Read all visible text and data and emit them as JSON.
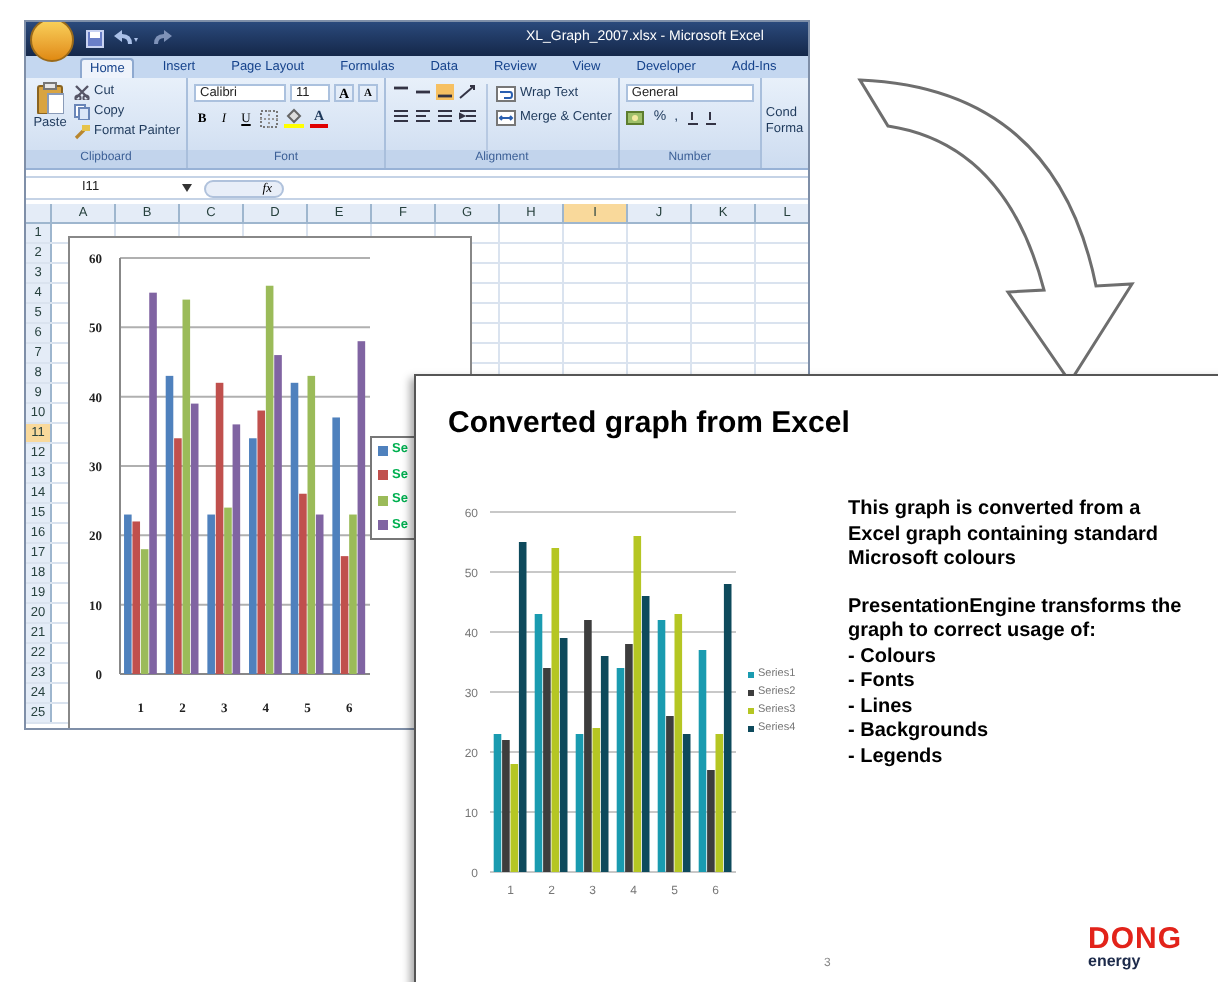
{
  "excel": {
    "title": "XL_Graph_2007.xlsx - Microsoft Excel",
    "tabs": [
      {
        "label": "Home",
        "selected": true
      },
      {
        "label": "Insert",
        "selected": false
      },
      {
        "label": "Page Layout",
        "selected": false
      },
      {
        "label": "Formulas",
        "selected": false
      },
      {
        "label": "Data",
        "selected": false
      },
      {
        "label": "Review",
        "selected": false
      },
      {
        "label": "View",
        "selected": false
      },
      {
        "label": "Developer",
        "selected": false
      },
      {
        "label": "Add-Ins",
        "selected": false
      }
    ],
    "clipboard": {
      "label": "Clipboard",
      "paste": "Paste",
      "items": [
        "Cut",
        "Copy",
        "Format Painter"
      ]
    },
    "font": {
      "label": "Font",
      "name": "Calibri",
      "size": "11",
      "grow": "A",
      "shrink": "A",
      "styles": [
        "B",
        "I",
        "U"
      ],
      "color_letter": "A"
    },
    "alignment": {
      "label": "Alignment",
      "wrap": "Wrap Text",
      "merge": "Merge & Center"
    },
    "number": {
      "label": "Number",
      "format": "General",
      "symbols": [
        "%",
        ","
      ]
    },
    "styles_cut": [
      "Cond",
      "Forma"
    ],
    "name_box": "I11",
    "fx": "fx",
    "columns": [
      {
        "label": "A",
        "selected": false
      },
      {
        "label": "B",
        "selected": false
      },
      {
        "label": "C",
        "selected": false
      },
      {
        "label": "D",
        "selected": false
      },
      {
        "label": "E",
        "selected": false
      },
      {
        "label": "F",
        "selected": false
      },
      {
        "label": "G",
        "selected": false
      },
      {
        "label": "H",
        "selected": false
      },
      {
        "label": "I",
        "selected": true
      },
      {
        "label": "J",
        "selected": false
      },
      {
        "label": "K",
        "selected": false
      },
      {
        "label": "L",
        "selected": false
      }
    ],
    "rows": [
      {
        "label": "1",
        "selected": false
      },
      {
        "label": "2",
        "selected": false
      },
      {
        "label": "3",
        "selected": false
      },
      {
        "label": "4",
        "selected": false
      },
      {
        "label": "5",
        "selected": false
      },
      {
        "label": "6",
        "selected": false
      },
      {
        "label": "7",
        "selected": false
      },
      {
        "label": "8",
        "selected": false
      },
      {
        "label": "9",
        "selected": false
      },
      {
        "label": "10",
        "selected": false
      },
      {
        "label": "11",
        "selected": true
      },
      {
        "label": "12",
        "selected": false
      },
      {
        "label": "13",
        "selected": false
      },
      {
        "label": "14",
        "selected": false
      },
      {
        "label": "15",
        "selected": false
      },
      {
        "label": "16",
        "selected": false
      },
      {
        "label": "17",
        "selected": false
      },
      {
        "label": "18",
        "selected": false
      },
      {
        "label": "19",
        "selected": false
      },
      {
        "label": "20",
        "selected": false
      },
      {
        "label": "21",
        "selected": false
      },
      {
        "label": "22",
        "selected": false
      },
      {
        "label": "23",
        "selected": false
      },
      {
        "label": "24",
        "selected": false
      },
      {
        "label": "25",
        "selected": false
      }
    ],
    "chart": {
      "legend": [
        {
          "label": "Se",
          "color": "#4f81bd"
        },
        {
          "label": "Se",
          "color": "#c0504d"
        },
        {
          "label": "Se",
          "color": "#9bbb59"
        },
        {
          "label": "Se",
          "color": "#8064a2"
        }
      ],
      "chart_data": {
        "type": "bar",
        "categories": [
          "1",
          "2",
          "3",
          "4",
          "5",
          "6"
        ],
        "series": [
          {
            "color": "#4f81bd",
            "values": [
              23,
              43,
              23,
              34,
              42,
              37
            ]
          },
          {
            "color": "#c0504d",
            "values": [
              22,
              34,
              42,
              38,
              26,
              17
            ]
          },
          {
            "color": "#9bbb59",
            "values": [
              18,
              54,
              24,
              56,
              43,
              23
            ]
          },
          {
            "color": "#8064a2",
            "values": [
              55,
              39,
              36,
              46,
              23,
              48
            ]
          }
        ],
        "ylim": [
          0,
          60
        ],
        "yticks": [
          0,
          10,
          20,
          30,
          40,
          50,
          60
        ],
        "grid": true
      }
    }
  },
  "slide": {
    "title": "Converted graph from Excel",
    "chart": {
      "chart_data": {
        "type": "bar",
        "categories": [
          "1",
          "2",
          "3",
          "4",
          "5",
          "6"
        ],
        "series": [
          {
            "name": "Series1",
            "color": "#1a9bb0",
            "values": [
              23,
              43,
              23,
              34,
              42,
              37
            ]
          },
          {
            "name": "Series2",
            "color": "#3d3d3d",
            "values": [
              22,
              34,
              42,
              38,
              26,
              17
            ]
          },
          {
            "name": "Series3",
            "color": "#b5c623",
            "values": [
              18,
              54,
              24,
              56,
              43,
              23
            ]
          },
          {
            "name": "Series4",
            "color": "#0e4a5c",
            "values": [
              55,
              39,
              36,
              46,
              23,
              48
            ]
          }
        ],
        "ylim": [
          0,
          60
        ],
        "yticks": [
          0,
          10,
          20,
          30,
          40,
          50,
          60
        ],
        "grid": true
      }
    },
    "paragraph_1": "This graph is converted from a Excel graph containing standard Microsoft colours",
    "paragraph_2": "PresentationEngine transforms the graph to correct usage of:",
    "bullets": [
      "- Colours",
      "- Fonts",
      "- Lines",
      "- Backgrounds",
      "- Legends"
    ],
    "page_number": "3",
    "logo": {
      "word": "DONG",
      "subword": "energy"
    }
  }
}
